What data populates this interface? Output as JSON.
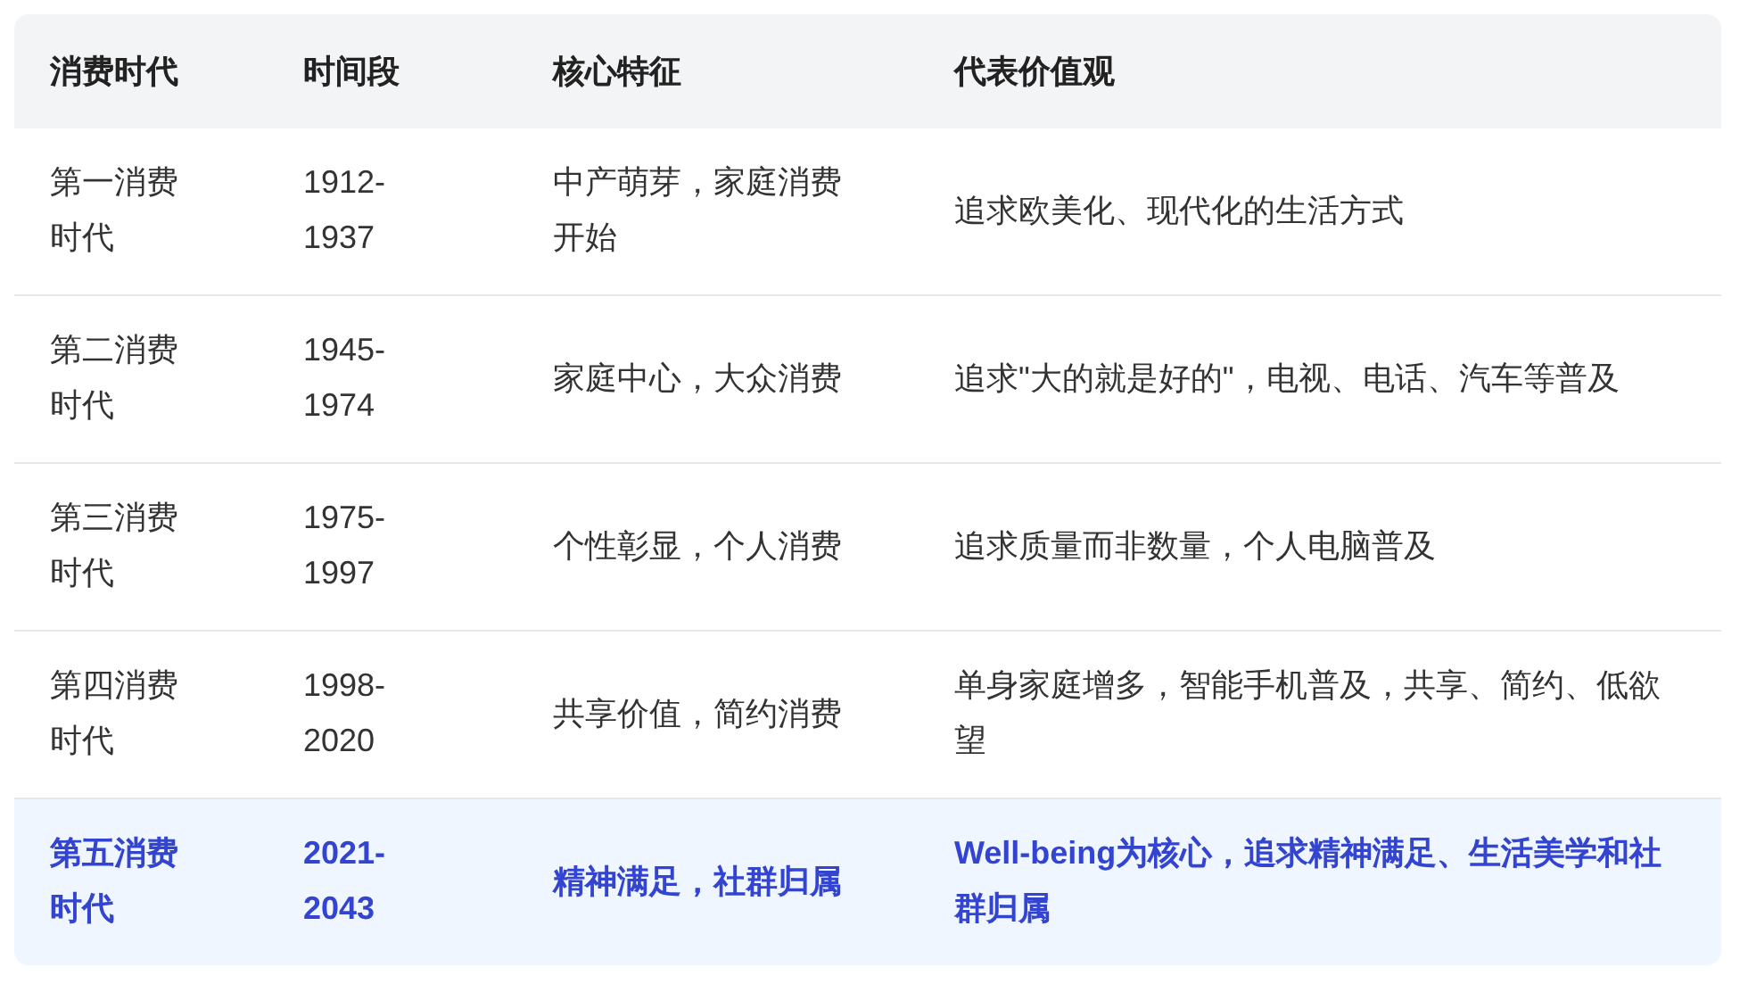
{
  "table": {
    "columns": [
      "消费时代",
      "时间段",
      "核心特征",
      "代表价值观"
    ],
    "rows": [
      {
        "selected": false,
        "cells": [
          "第一消费时代",
          "1912-1937",
          "中产萌芽，家庭消费开始",
          "追求欧美化、现代化的生活方式"
        ]
      },
      {
        "selected": false,
        "cells": [
          "第二消费时代",
          "1945-1974",
          "家庭中心，大众消费",
          "追求\"大的就是好的\"，电视、电话、汽车等普及"
        ]
      },
      {
        "selected": false,
        "cells": [
          "第三消费时代",
          "1975-1997",
          "个性彰显，个人消费",
          "追求质量而非数量，个人电脑普及"
        ]
      },
      {
        "selected": false,
        "cells": [
          "第四消费时代",
          "1998-2020",
          "共享价值，简约消费",
          "单身家庭增多，智能手机普及，共享、简约、低欲望"
        ]
      },
      {
        "selected": true,
        "cells": [
          "第五消费时代",
          "2021-2043",
          "精神满足，社群归属",
          "Well-being为核心，追求精神满足、生活美学和社群归属"
        ]
      }
    ]
  }
}
